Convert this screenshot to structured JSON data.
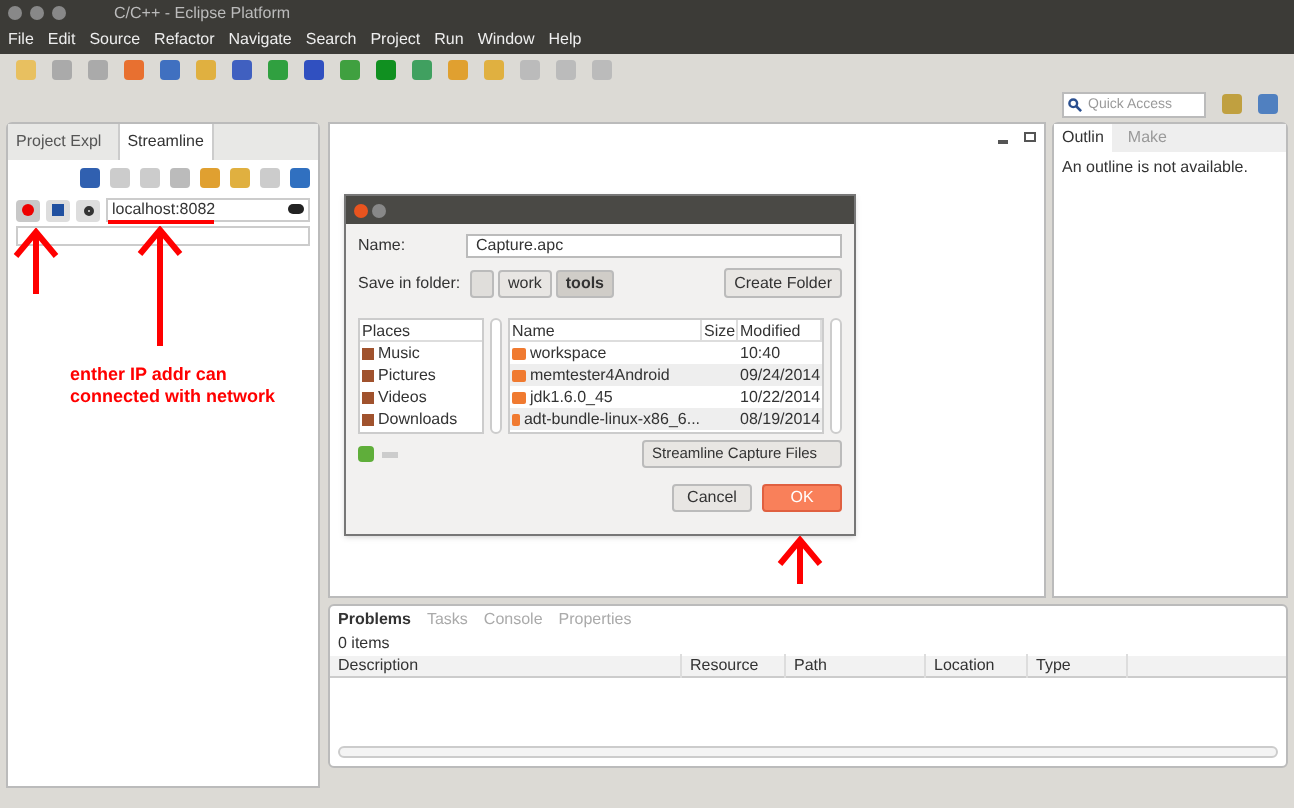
{
  "window": {
    "title": "C/C++ - Eclipse Platform"
  },
  "menu": [
    "File",
    "Edit",
    "Source",
    "Refactor",
    "Navigate",
    "Search",
    "Project",
    "Run",
    "Window",
    "Help"
  ],
  "quick_access": {
    "placeholder": "Quick Access"
  },
  "left_panel": {
    "tabs": [
      {
        "label": "Project Expl",
        "selected": false
      },
      {
        "label": "Streamline",
        "selected": true
      }
    ],
    "connection": {
      "value": "localhost:8082"
    }
  },
  "annotation": "enther IP addr can connected with network",
  "outline": {
    "tabs": [
      {
        "label": "Outlin",
        "selected": true
      },
      {
        "label": "Make",
        "selected": false
      }
    ],
    "message": "An outline is not available."
  },
  "problems": {
    "tabs": [
      {
        "label": "Problems",
        "selected": true
      },
      {
        "label": "Tasks",
        "selected": false
      },
      {
        "label": "Console",
        "selected": false
      },
      {
        "label": "Properties",
        "selected": false
      }
    ],
    "count": "0 items",
    "columns": [
      "Description",
      "Resource",
      "Path",
      "Location",
      "Type"
    ]
  },
  "dialog": {
    "name_label": "Name:",
    "name_value": "Capture.apc",
    "folder_label": "Save in folder:",
    "path": [
      {
        "label": "work",
        "selected": false
      },
      {
        "label": "tools",
        "selected": true
      }
    ],
    "create_folder": "Create Folder",
    "places_header": "Places",
    "places": [
      "Music",
      "Pictures",
      "Videos",
      "Downloads"
    ],
    "file_columns": [
      "Name",
      "Size",
      "Modified"
    ],
    "files": [
      {
        "name": "workspace",
        "modified": "10:40"
      },
      {
        "name": "memtester4Android",
        "modified": "09/24/2014"
      },
      {
        "name": "jdk1.6.0_45",
        "modified": "10/22/2014"
      },
      {
        "name": "adt-bundle-linux-x86_6...",
        "modified": "08/19/2014"
      }
    ],
    "filter": "Streamline Capture Files",
    "cancel": "Cancel",
    "ok": "OK"
  }
}
